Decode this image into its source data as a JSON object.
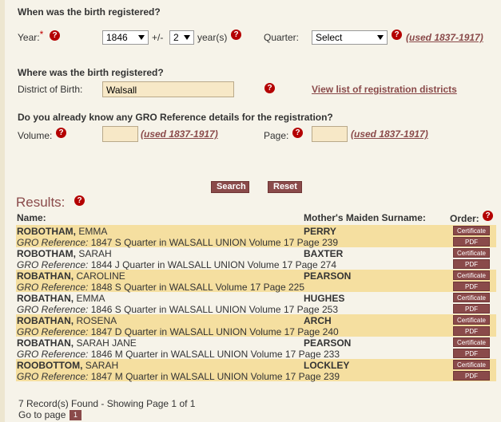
{
  "section_when": {
    "heading": "When was the birth registered?",
    "year_label": "Year:",
    "required_mark": "*",
    "year_value": "1846",
    "plusminus_label": "+/-",
    "range_value": "2",
    "years_label": "year(s)",
    "quarter_label": "Quarter:",
    "quarter_value": "Select",
    "used_note": "(used 1837-1917)"
  },
  "section_where": {
    "heading": "Where was the birth registered?",
    "district_label": "District of Birth:",
    "district_value": "Walsall",
    "view_link": "View list of registration districts"
  },
  "section_gro": {
    "heading": "Do you already know any GRO Reference details for the registration?",
    "volume_label": "Volume:",
    "volume_value": "",
    "used_note_volume": "(used 1837-1917)",
    "page_label": "Page:",
    "page_value": "",
    "used_note_page": "(used 1837-1917)"
  },
  "help_glyph": "?",
  "buttons": {
    "search": "Search",
    "reset": "Reset"
  },
  "results": {
    "title": "Results:",
    "col_name": "Name:",
    "col_maiden": "Mother's Maiden Surname:",
    "col_order": "Order:",
    "gro_prefix": "GRO Reference:",
    "cert_label": "Certificate",
    "pdf_label": "PDF",
    "rows": [
      {
        "surname": "ROBOTHAM,",
        "forenames": "EMMA",
        "ref": "1847  S Quarter in WALSALL UNION  Volume 17  Page 239",
        "maiden": "PERRY"
      },
      {
        "surname": "ROBOTHAM,",
        "forenames": "SARAH",
        "ref": "1844  J Quarter in WALSALL UNION  Volume 17  Page 274",
        "maiden": "BAXTER"
      },
      {
        "surname": "ROBATHAN,",
        "forenames": "CAROLINE",
        "ref": "1848  S Quarter in WALSALL  Volume 17  Page 225",
        "maiden": "PEARSON"
      },
      {
        "surname": "ROBATHAN,",
        "forenames": "EMMA",
        "ref": "1846  S Quarter in WALSALL UNION  Volume 17  Page 253",
        "maiden": "HUGHES"
      },
      {
        "surname": "ROBATHAN,",
        "forenames": "ROSENA",
        "ref": "1847  D Quarter in WALSALL UNION  Volume 17  Page 240",
        "maiden": "ARCH"
      },
      {
        "surname": "ROBATHAN,",
        "forenames": "SARAH  JANE",
        "ref": "1846  M Quarter in WALSALL UNION  Volume 17  Page 233",
        "maiden": "PEARSON"
      },
      {
        "surname": "ROOBOTTOM,",
        "forenames": "SARAH",
        "ref": "1847  M Quarter in WALSALL UNION  Volume 17  Page 239",
        "maiden": "LOCKLEY"
      }
    ]
  },
  "footer": {
    "records_text": "7 Record(s) Found - Showing Page 1 of 1",
    "goto_label": "Go to page",
    "page_number": "1"
  }
}
